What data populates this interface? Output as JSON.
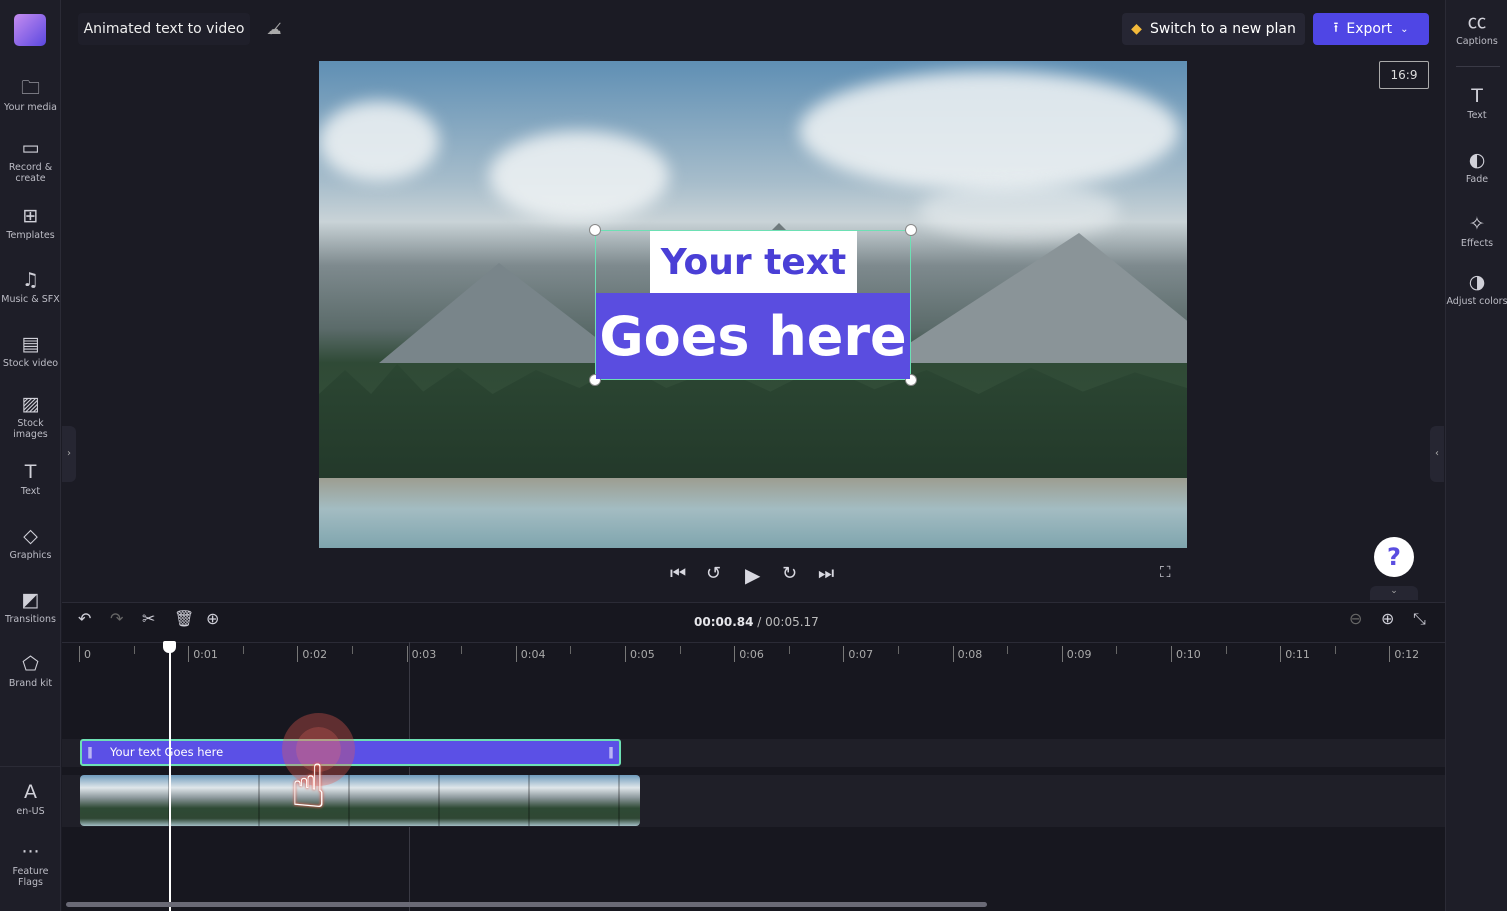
{
  "app": {
    "project_title": "Animated text to video",
    "cloud_status_icon": "cloud-off-icon"
  },
  "header": {
    "upgrade_label": "Switch to a new plan",
    "export_label": "Export",
    "aspect_ratio": "16:9",
    "accent": "#4f46e5"
  },
  "left_sidebar": [
    {
      "label": "Your media",
      "icon": "folder-icon",
      "glyph": "🗀"
    },
    {
      "label": "Record & create",
      "icon": "camera-icon",
      "glyph": "▭"
    },
    {
      "label": "Templates",
      "icon": "templates-icon",
      "glyph": "⊞"
    },
    {
      "label": "Music & SFX",
      "icon": "music-icon",
      "glyph": "♫"
    },
    {
      "label": "Stock video",
      "icon": "film-icon",
      "glyph": "▤"
    },
    {
      "label": "Stock images",
      "icon": "image-icon",
      "glyph": "▨"
    },
    {
      "label": "Text",
      "icon": "text-icon",
      "glyph": "T"
    },
    {
      "label": "Graphics",
      "icon": "shapes-icon",
      "glyph": "◇"
    },
    {
      "label": "Transitions",
      "icon": "transitions-icon",
      "glyph": "◩"
    },
    {
      "label": "Brand kit",
      "icon": "brand-icon",
      "glyph": "⬠"
    }
  ],
  "left_bottom": [
    {
      "label": "en-US",
      "icon": "language-icon",
      "glyph": "A"
    },
    {
      "label": "Feature Flags",
      "icon": "more-icon",
      "glyph": "···"
    }
  ],
  "right_sidebar": [
    {
      "label": "Captions",
      "icon": "cc-icon",
      "glyph": "㏄"
    },
    {
      "label": "Text",
      "icon": "text-icon",
      "glyph": "T"
    },
    {
      "label": "Fade",
      "icon": "fade-icon",
      "glyph": "◐"
    },
    {
      "label": "Effects",
      "icon": "magic-wand-icon",
      "glyph": "✧"
    },
    {
      "label": "Adjust colors",
      "icon": "contrast-icon",
      "glyph": "◑"
    }
  ],
  "canvas": {
    "text_line1": "Your text",
    "text_line2": "Goes here"
  },
  "player": {
    "current_time": "00:00.84",
    "total_time": "/ 00:05.17"
  },
  "timeline": {
    "ticks": [
      "0",
      "0:01",
      "0:02",
      "0:03",
      "0:04",
      "0:05",
      "0:06",
      "0:07",
      "0:08",
      "0:09",
      "0:10",
      "0:11",
      "0:12"
    ],
    "text_clip_label": "Your text Goes here",
    "playhead_seconds": 0.84,
    "duration_seconds": 5.17
  }
}
